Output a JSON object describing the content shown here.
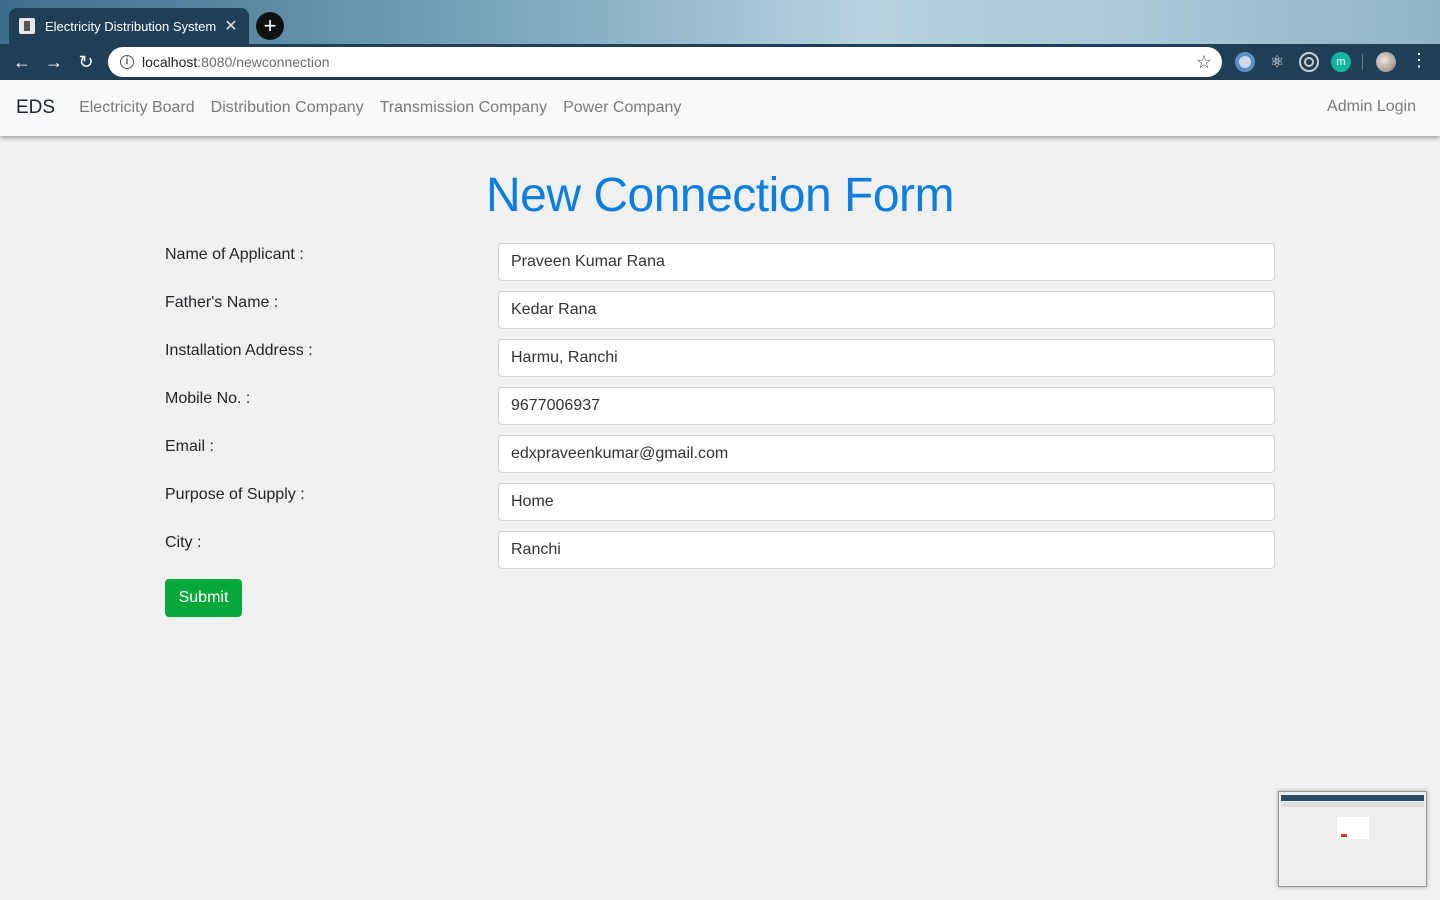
{
  "browser": {
    "tab_title": "Electricity Distribution System",
    "url_host": "localhost",
    "url_rest": ":8080/newconnection",
    "ext_m_label": "m"
  },
  "nav": {
    "brand": "EDS",
    "links": [
      "Electricity Board",
      "Distribution Company",
      "Transmission Company",
      "Power Company"
    ],
    "admin": "Admin Login"
  },
  "form": {
    "heading": "New Connection Form",
    "fields": [
      {
        "label": "Name of Applicant :",
        "value": "Praveen Kumar Rana"
      },
      {
        "label": "Father's Name :",
        "value": "Kedar Rana"
      },
      {
        "label": "Installation Address :",
        "value": "Harmu, Ranchi"
      },
      {
        "label": "Mobile No. :",
        "value": "9677006937"
      },
      {
        "label": "Email :",
        "value": "edxpraveenkumar@gmail.com"
      },
      {
        "label": "Purpose of Supply :",
        "value": "Home"
      },
      {
        "label": "City :",
        "value": "Ranchi"
      }
    ],
    "submit": "Submit"
  },
  "colors": {
    "heading": "#0b7ee0",
    "submit": "#06a839",
    "background": "#f0f0f0"
  }
}
